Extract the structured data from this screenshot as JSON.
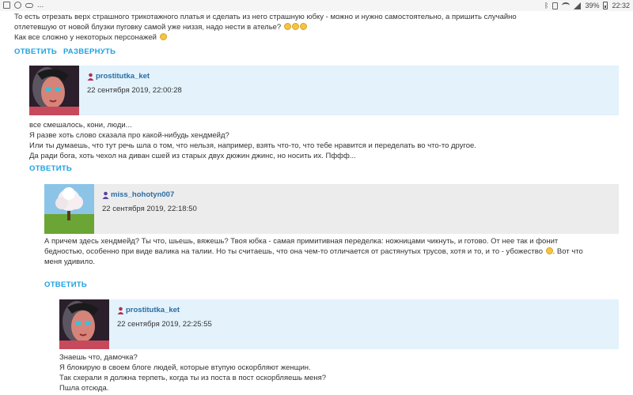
{
  "statusbar": {
    "battery": "39%",
    "time": "22:32",
    "overflow": "..."
  },
  "top_comment": {
    "lines": [
      "То есть отрезать верх страшного трикотажного платья и сделать из него страшную юбку - можно и нужно самостоятельно, а пришить случайно",
      "отлетевшую от новой блузки пуговку самой уже низзя, надо нести в ателье?",
      "Как все сложно у некоторых персонажей"
    ],
    "reply_label": "ОТВЕТИТЬ",
    "expand_label": "РАЗВЕРНУТЬ"
  },
  "comment1": {
    "username": "prostitutka_ket",
    "date": "22 сентября 2019, 22:00:28",
    "lines": [
      "все смешалось, кони, люди...",
      "Я разве хоть слово сказала про какой-нибудь хендмейд?",
      "Или ты думаешь, что тут речь шла о том, что нельзя, например, взять что-то, что тебе нравится и переделать во что-то другое.",
      "Да ради бога, хоть чехол на диван сшей из старых двух дюжин джинс, но носить их. Пффф..."
    ],
    "reply_label": "ОТВЕТИТЬ"
  },
  "comment2": {
    "username": "miss_hohotyn007",
    "date": "22 сентября 2019, 22:18:50",
    "text": "А причем здесь хендмейд? Ты что, шьешь, вяжешь? Твоя юбка - самая примитивная переделка: ножницами чикнуть, и готово. От нее так и фонит бедностью, особенно при виде валика на талии. Но ты считаешь, что она чем-то отличается от растянутых трусов, хотя и то, и то - убожество",
    "text_end": ". Вот что меня удивило.",
    "reply_label": "ОТВЕТИТЬ"
  },
  "comment3": {
    "username": "prostitutka_ket",
    "date": "22 сентября 2019, 22:25:55",
    "lines": [
      "Знаешь что, дамочка?",
      "Я блокирую в своем блоге людей, которые втупую оскорбляют женщин.",
      "Так схерали я должна терпеть, когда ты из поста в пост оскорбляешь меня?",
      "Пшла отсюда."
    ]
  }
}
